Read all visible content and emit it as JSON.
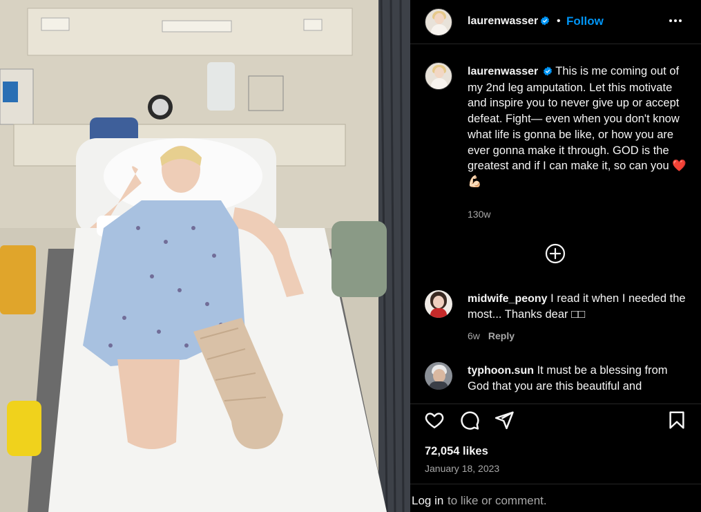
{
  "post": {
    "username": "laurenwasser",
    "follow_label": "Follow",
    "separator": "•",
    "photo_description": "Hospital photo"
  },
  "caption": {
    "username": "laurenwasser",
    "text": "This is me coming out of my 2nd leg amputation. Let this motivate and inspire you to never give up or accept defeat. Fight— even when you don't know what life is gonna be like, or how you are ever gonna make it through. GOD is the greatest and if I can make it, so can you ❤️ 💪🏻",
    "age": "130w"
  },
  "comments": [
    {
      "username": "midwife_peony",
      "text": "I read it when I needed the most... Thanks dear ",
      "trailing_glyphs": "□□",
      "age": "6w",
      "reply_label": "Reply"
    },
    {
      "username": "typhoon.sun",
      "text": "It must be a blessing from God that you are this beautiful and"
    }
  ],
  "stats": {
    "likes": "72,054 likes",
    "date": "January 18, 2023"
  },
  "footer": {
    "login_label": "Log in",
    "rest_text": "to like or comment."
  },
  "icons": {
    "verified": "verified-badge-icon",
    "more": "more-options-icon",
    "load_more": "plus-circle-icon",
    "like": "heart-icon",
    "comment": "comment-icon",
    "share": "share-icon",
    "save": "bookmark-icon"
  },
  "colors": {
    "accent": "#0095f6",
    "muted": "#a8a8a8",
    "background": "#000000",
    "text": "#f5f5f5"
  }
}
